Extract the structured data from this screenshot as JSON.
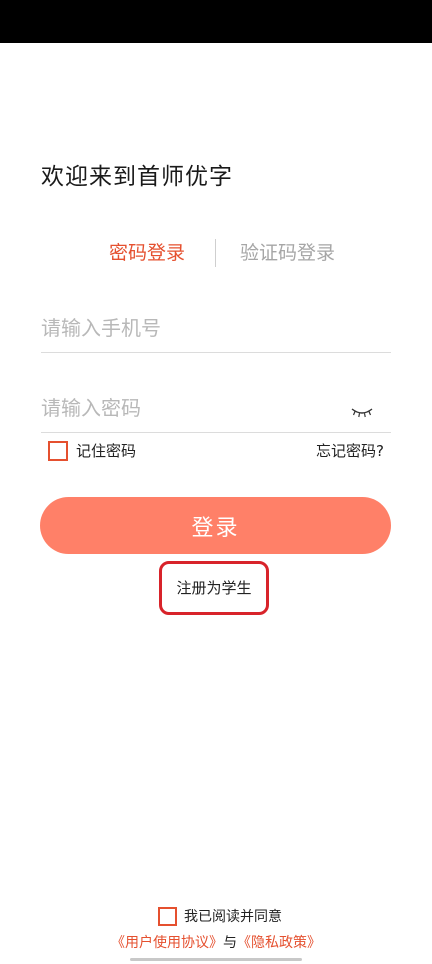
{
  "welcome": {
    "title": "欢迎来到首师优字"
  },
  "tabs": {
    "password_login": "密码登录",
    "code_login": "验证码登录"
  },
  "form": {
    "phone_placeholder": "请输入手机号",
    "phone_value": "",
    "password_placeholder": "请输入密码",
    "password_value": "",
    "remember_label": "记住密码",
    "forgot_label": "忘记密码?",
    "login_label": "登录",
    "register_label": "注册为学生"
  },
  "footer": {
    "agree_label": "我已阅读并同意",
    "user_agreement": "《用户使用协议》",
    "and_text": "与",
    "privacy_policy": "《隐私政策》"
  },
  "icons": {
    "eye": "eye-closed-icon",
    "checkbox": "checkbox-icon"
  },
  "colors": {
    "accent": "#e5502f",
    "button": "#ff8068",
    "highlight": "#d8232a",
    "muted": "#a6a6a6"
  }
}
